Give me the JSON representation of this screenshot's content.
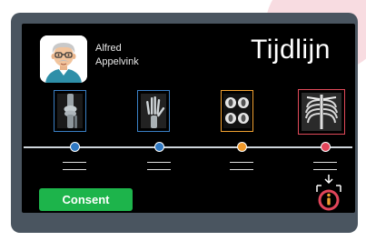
{
  "patient": {
    "first_name": "Alfred",
    "last_name": "Appelvink"
  },
  "page_title": "Tijdlijn",
  "timeline": [
    {
      "image": "knee-xray",
      "border_color": "#3a7fc4",
      "dot_color": "#2f78c2"
    },
    {
      "image": "hand-xray",
      "border_color": "#3a7fc4",
      "dot_color": "#2f78c2"
    },
    {
      "image": "brain-ct-scans",
      "border_color": "#f0a030",
      "dot_color": "#f19a2b"
    },
    {
      "image": "chest-xray",
      "border_color": "#e14a5a",
      "dot_color": "#e2455a"
    }
  ],
  "consent_button": "Consent",
  "colors": {
    "device_frame": "#4a5560",
    "screen_background": "#000000",
    "consent_green": "#1db44b",
    "accent_red": "#e2455a"
  }
}
